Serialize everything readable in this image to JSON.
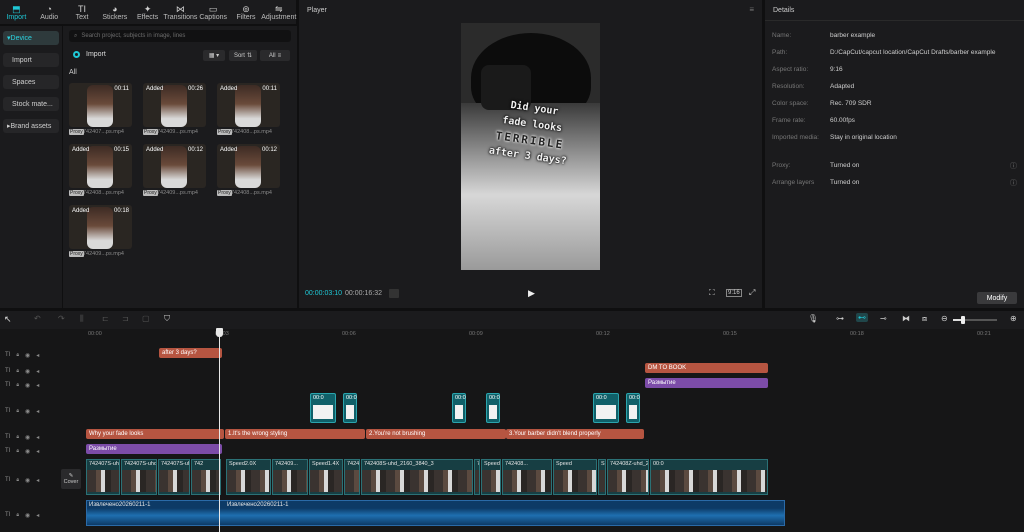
{
  "toolbar": {
    "items": [
      {
        "label": "Import",
        "icon": "import-icon",
        "glyph": "⬒"
      },
      {
        "label": "Audio",
        "icon": "audio-icon",
        "glyph": "◔"
      },
      {
        "label": "Text",
        "icon": "text-icon",
        "glyph": "TI"
      },
      {
        "label": "Stickers",
        "icon": "stickers-icon",
        "glyph": "◕"
      },
      {
        "label": "Effects",
        "icon": "effects-icon",
        "glyph": "✦"
      },
      {
        "label": "Transitions",
        "icon": "transitions-icon",
        "glyph": "⋈"
      },
      {
        "label": "Captions",
        "icon": "captions-icon",
        "glyph": "▭"
      },
      {
        "label": "Filters",
        "icon": "filters-icon",
        "glyph": "⊚"
      },
      {
        "label": "Adjustment",
        "icon": "adjustment-icon",
        "glyph": "⇋"
      }
    ]
  },
  "sidebar": {
    "items": [
      {
        "label": "Device",
        "prefix": "▾ "
      },
      {
        "label": "Import",
        "prefix": ""
      },
      {
        "label": "Spaces",
        "prefix": ""
      },
      {
        "label": "Stock mate...",
        "prefix": ""
      },
      {
        "label": "Brand assets",
        "prefix": "▸ "
      }
    ]
  },
  "media": {
    "search_placeholder": "Search project, subjects in image, lines",
    "import_label": "Import",
    "sort_label": "Sort",
    "all_filter_label": "All",
    "section_label": "All",
    "proxy_label": "Proxy",
    "items": [
      {
        "duration": "00:11",
        "added": "",
        "name": "742407...ps.mp4"
      },
      {
        "duration": "00:26",
        "added": "Added",
        "name": "742409...ps.mp4"
      },
      {
        "duration": "00:11",
        "added": "Added",
        "name": "742408...ps.mp4"
      },
      {
        "duration": "00:15",
        "added": "Added",
        "name": "742408...ps.mp4"
      },
      {
        "duration": "00:12",
        "added": "Added",
        "name": "742409...ps.mp4"
      },
      {
        "duration": "00:12",
        "added": "Added",
        "name": "742408...ps.mp4"
      },
      {
        "duration": "00:18",
        "added": "Added",
        "name": "742409...ps.mp4"
      }
    ]
  },
  "player": {
    "title": "Player",
    "overlay_lines": [
      "Did your",
      "fade looks",
      "TERRIBLE",
      "after 3 days?"
    ],
    "current_time": "00:00:03:10",
    "total_time": "00:00:16:32",
    "ratio_label": "9:16"
  },
  "details": {
    "title": "Details",
    "rows": [
      {
        "label": "Name:",
        "value": "barber example"
      },
      {
        "label": "Path:",
        "value": "D:/CapCut/capcut location/CapCut Drafts/barber example"
      },
      {
        "label": "Aspect ratio:",
        "value": "9:16"
      },
      {
        "label": "Resolution:",
        "value": "Adapted"
      },
      {
        "label": "Color space:",
        "value": "Rec. 709 SDR"
      },
      {
        "label": "Frame rate:",
        "value": "60.00fps"
      },
      {
        "label": "Imported media:",
        "value": "Stay in original location"
      },
      {
        "label": "Proxy:",
        "value": "Turned on"
      },
      {
        "label": "Arrange layers",
        "value": "Turned on"
      }
    ],
    "modify_label": "Modify"
  },
  "timeline": {
    "ruler": [
      "00:00",
      "00:03",
      "00:06",
      "00:09",
      "00:12",
      "00:15",
      "00:18",
      "00:21"
    ],
    "cover_label": "Cover",
    "text_clips_top": [
      {
        "text": "after 3 days?"
      },
      {
        "text": "DM TO BOOK"
      }
    ],
    "blur_label": "Размытие",
    "fx_label": "00:0",
    "captions": [
      {
        "text": "Why your fade looks"
      },
      {
        "text": "1.It's the wrong styling"
      },
      {
        "text": "2.You're not brushing"
      },
      {
        "text": "3.Your barber didn't blend properly"
      }
    ],
    "video_clips": [
      {
        "text": "742407S-uh"
      },
      {
        "text": "742407S-uhd_2"
      },
      {
        "text": "742407S-uhd_2"
      },
      {
        "text": "742"
      },
      {
        "text": "Speed2.0X"
      },
      {
        "text": "742409..."
      },
      {
        "text": "Speed1.4X"
      },
      {
        "text": "742408..."
      },
      {
        "text": "742408S-uhd_2160_3840_3"
      },
      {
        "text": "7"
      },
      {
        "text": "Speed1.4X"
      },
      {
        "text": "742408..."
      },
      {
        "text": "Speed"
      },
      {
        "text": "S"
      },
      {
        "text": "742408Z-uhd_2160_3840_30fps.mp4"
      },
      {
        "text": "00:0"
      }
    ],
    "audio_label_1": "Извлечено20260211-1",
    "audio_label_2": "Извлечено20260211-1"
  }
}
